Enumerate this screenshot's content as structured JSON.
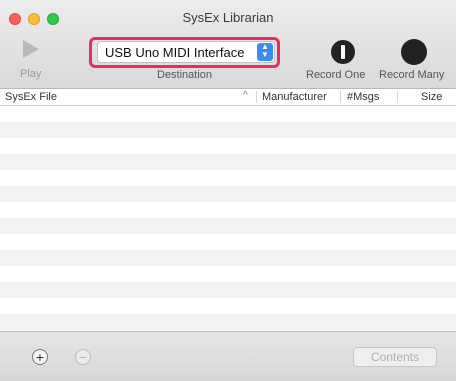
{
  "window": {
    "title": "SysEx Librarian"
  },
  "toolbar": {
    "play_label": "Play",
    "destination": {
      "value": "USB Uno MIDI Interface",
      "label": "Destination"
    },
    "record_one_label": "Record One",
    "record_many_label": "Record Many"
  },
  "table": {
    "columns": [
      "SysEx File",
      "Manufacturer",
      "#Msgs",
      "Size"
    ],
    "sort_indicator": "^",
    "rows": []
  },
  "bottom": {
    "add_symbol": "+",
    "remove_symbol": "−",
    "contents_label": "Contents"
  },
  "colors": {
    "highlight": "#e5305d",
    "popup_accent": "#3b8cf0",
    "close": "#fc615d",
    "minimize": "#fdbc40",
    "zoom": "#34c84a"
  }
}
